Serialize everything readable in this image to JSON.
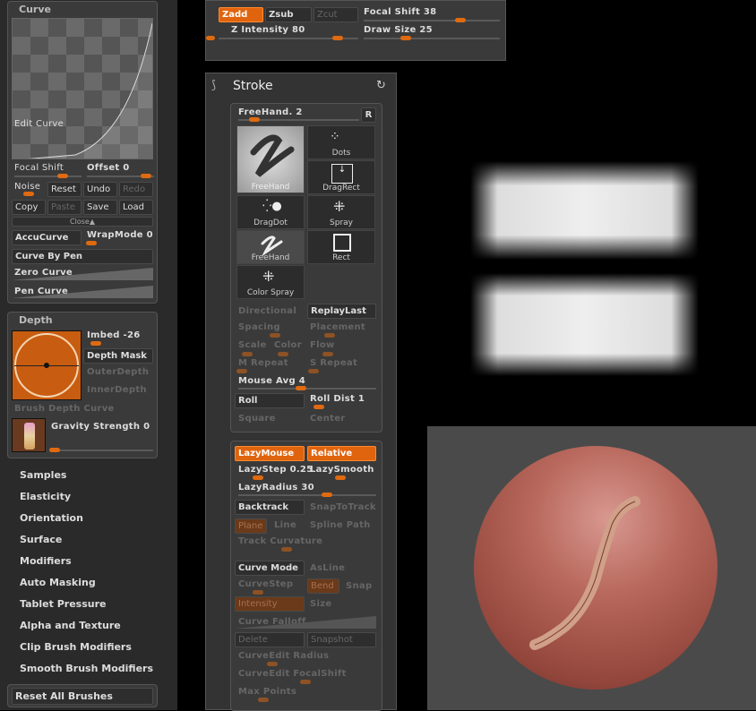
{
  "curve": {
    "title": "Curve",
    "edit_curve": "Edit Curve",
    "focal_shift": "Focal Shift",
    "offset": "Offset 0",
    "noise": "Noise",
    "reset": "Reset",
    "undo": "Undo",
    "redo": "Redo",
    "copy": "Copy",
    "paste": "Paste",
    "save": "Save",
    "load": "Load",
    "close": "Close",
    "accucurve": "AccuCurve",
    "wrapmode": "WrapMode 0",
    "curve_by_pen": "Curve By Pen",
    "zero_curve": "Zero Curve",
    "pen_curve": "Pen Curve"
  },
  "depth": {
    "title": "Depth",
    "imbed": "Imbed -26",
    "depth_mask": "Depth Mask",
    "outer_depth": "OuterDepth",
    "inner_depth": "InnerDepth",
    "brush_depth_curve": "Brush Depth Curve",
    "gravity_strength": "Gravity Strength 0"
  },
  "menu": [
    "Samples",
    "Elasticity",
    "Orientation",
    "Surface",
    "Modifiers",
    "Auto Masking",
    "Tablet Pressure",
    "Alpha and Texture",
    "Clip Brush Modifiers",
    "Smooth Brush Modifiers"
  ],
  "reset_all": "Reset All Brushes",
  "top": {
    "zadd": "Zadd",
    "zsub": "Zsub",
    "zcut": "Zcut",
    "focal_shift": "Focal Shift 38",
    "z_intensity": "Z Intensity 80",
    "draw_size": "Draw Size 25"
  },
  "stroke": {
    "title": "Stroke",
    "freehand2": "FreeHand. 2",
    "r": "R",
    "tiles": [
      "FreeHand",
      "Dots",
      "DragRect",
      "DragDot",
      "Spray",
      "FreeHand",
      "Rect",
      "Color Spray"
    ],
    "directional": "Directional",
    "replaylast": "ReplayLast",
    "spacing": "Spacing",
    "placement": "Placement",
    "scale": "Scale",
    "color": "Color",
    "flow": "Flow",
    "m_repeat": "M Repeat",
    "s_repeat": "S Repeat",
    "mouse_avg": "Mouse Avg 4",
    "roll": "Roll",
    "roll_dist": "Roll Dist 1",
    "square": "Square",
    "center": "Center"
  },
  "lazy": {
    "lazymouse": "LazyMouse",
    "relative": "Relative",
    "lazystep": "LazyStep 0.25",
    "lazysmooth": "LazySmooth",
    "lazyradius": "LazyRadius 30",
    "backtrack": "Backtrack",
    "snaptotrack": "SnapToTrack",
    "plane": "Plane",
    "line": "Line",
    "spline_path": "Spline Path",
    "track_curvature": "Track Curvature",
    "curve_mode": "Curve Mode",
    "asline": "AsLine",
    "curvestep": "CurveStep",
    "bend": "Bend",
    "snap": "Snap",
    "intensity": "Intensity",
    "size": "Size",
    "curve_falloff": "Curve Falloff",
    "delete": "Delete",
    "snapshot": "Snapshot",
    "curveedit_radius": "CurveEdit Radius",
    "curveedit_focalshift": "CurveEdit FocalShift",
    "max_points": "Max Points"
  },
  "colors": {
    "accent": "#e0640e",
    "panel": "#3a3a3a",
    "sphere": "#a0584c",
    "viewport": "#4a4a4a"
  }
}
